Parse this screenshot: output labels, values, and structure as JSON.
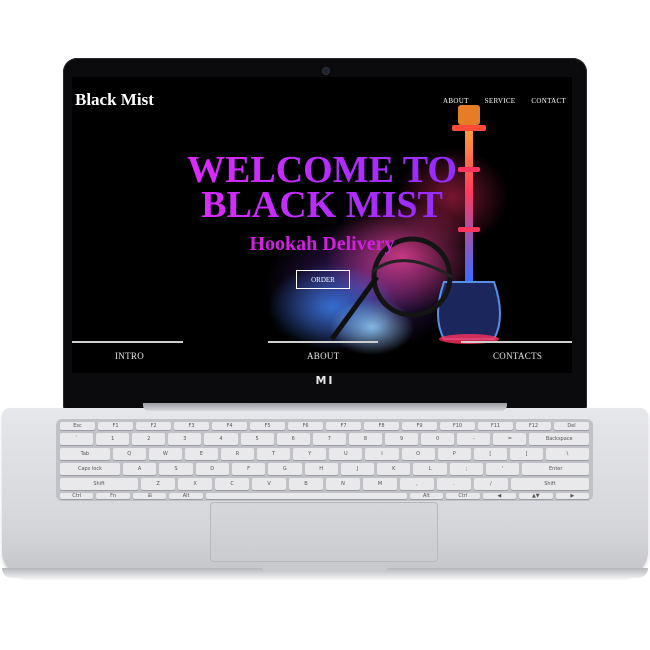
{
  "site": {
    "logo": "Black Mist",
    "nav": [
      "ABOUT",
      "SERVICE",
      "CONTACT"
    ],
    "hero_line1": "WELCOME TO",
    "hero_line2": "BLACK MIST",
    "subtitle": "Hookah Delivery",
    "order_label": "ORDER",
    "sections": [
      "INTRO",
      "ABOUT",
      "CONTACTS"
    ]
  },
  "device": {
    "brand_mark": "MI"
  },
  "keyboard": {
    "row_fn": [
      "Esc",
      "F1",
      "F2",
      "F3",
      "F4",
      "F5",
      "F6",
      "F7",
      "F8",
      "F9",
      "F10",
      "F11",
      "F12",
      "Del"
    ],
    "row_num": [
      "`",
      "1",
      "2",
      "3",
      "4",
      "5",
      "6",
      "7",
      "8",
      "9",
      "0",
      "-",
      "=",
      "Backspace"
    ],
    "row_q": [
      "Tab",
      "Q",
      "W",
      "E",
      "R",
      "T",
      "Y",
      "U",
      "I",
      "O",
      "P",
      "[",
      "]",
      "\\"
    ],
    "row_a": [
      "Caps lock",
      "A",
      "S",
      "D",
      "F",
      "G",
      "H",
      "J",
      "K",
      "L",
      ";",
      "'",
      "Enter"
    ],
    "row_z": [
      "Shift",
      "Z",
      "X",
      "C",
      "V",
      "B",
      "N",
      "M",
      ",",
      ".",
      "/",
      "Shift"
    ],
    "row_bottom": [
      "Ctrl",
      "Fn",
      "⊞",
      "Alt",
      "",
      "Alt",
      "Ctrl",
      "◀",
      "▲▼",
      "▶"
    ]
  },
  "colors": {
    "hero_gradient_start": "#ff26ff",
    "hero_gradient_end": "#6f2cff",
    "subtitle": "#d21fe0",
    "screen_bg": "#000000",
    "laptop_body": "#dcdde0"
  }
}
